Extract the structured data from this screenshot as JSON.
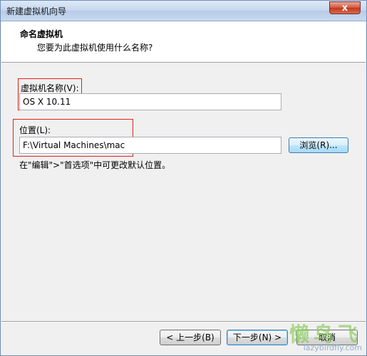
{
  "window": {
    "title": "新建虚拟机向导",
    "close_glyph": "x"
  },
  "header": {
    "title": "命名虚拟机",
    "subtitle": "您要为此虚拟机使用什么名称?"
  },
  "form": {
    "vm_name_label": "虚拟机名称(V):",
    "vm_name_value": "OS X 10.11",
    "location_label": "位置(L):",
    "location_value": "F:\\Virtual Machines\\mac",
    "browse_label": "浏览(R)...",
    "hint": "在\"编辑\">\"首选项\"中可更改默认位置。"
  },
  "footer": {
    "back_label": "< 上一步(B)",
    "next_label": "下一步(N) >",
    "cancel_label": "取消"
  },
  "watermark": {
    "chars": "懒鸟飞",
    "url": "lazybirdfly.com"
  },
  "colors": {
    "highlight_box": "#e02020"
  }
}
